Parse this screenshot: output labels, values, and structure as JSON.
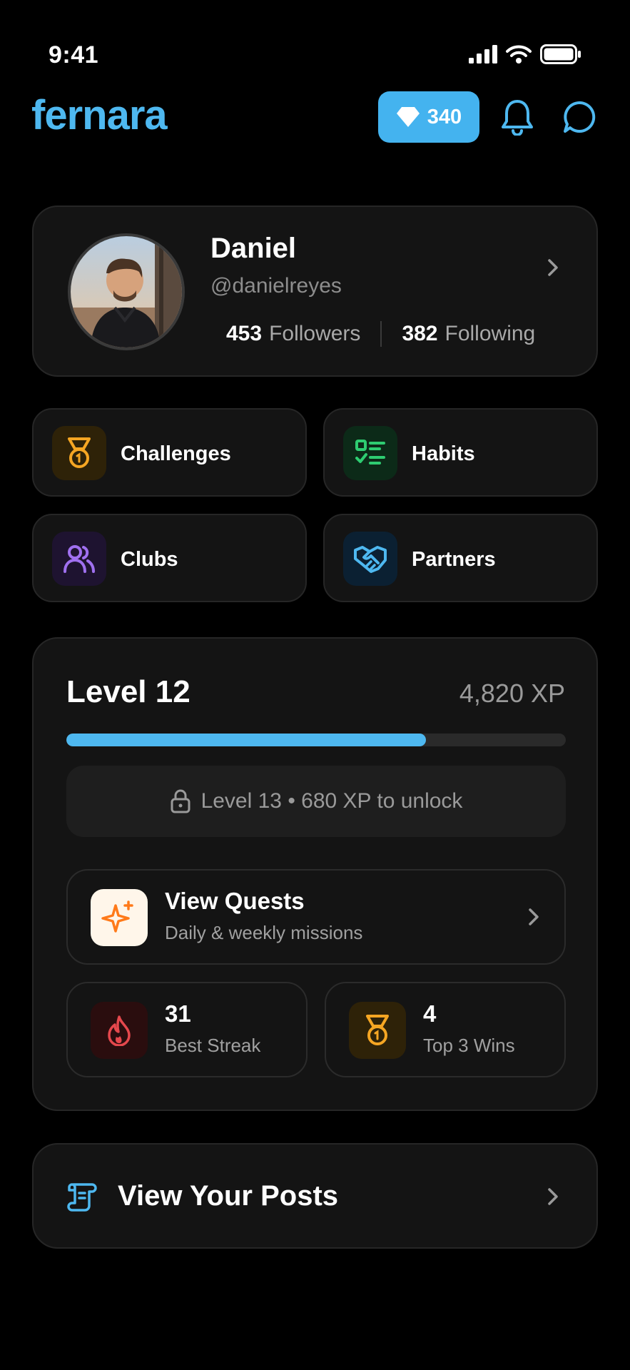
{
  "status": {
    "time": "9:41"
  },
  "header": {
    "logo": "fernara",
    "gems": "340"
  },
  "profile": {
    "name": "Daniel",
    "handle": "@danielreyes",
    "followers_count": "453",
    "followers_label": "Followers",
    "following_count": "382",
    "following_label": "Following"
  },
  "tiles": {
    "challenges": "Challenges",
    "habits": "Habits",
    "clubs": "Clubs",
    "partners": "Partners"
  },
  "level": {
    "title": "Level 12",
    "xp": "4,820 XP",
    "progress_percent": 72,
    "unlock_text": "Level 13 • 680 XP to unlock",
    "quests_title": "View Quests",
    "quests_sub": "Daily & weekly missions",
    "streak_value": "31",
    "streak_label": "Best Streak",
    "wins_value": "4",
    "wins_label": "Top 3 Wins"
  },
  "posts": {
    "label": "View Your Posts"
  },
  "colors": {
    "accent": "#4eb8f0",
    "background": "#000000",
    "card": "#141414",
    "challenge": "#f5a623",
    "habits": "#2ecc71",
    "clubs": "#a070f0",
    "partners": "#4eb8f0",
    "streak": "#e5484d",
    "quests": "#ff7a1a"
  }
}
